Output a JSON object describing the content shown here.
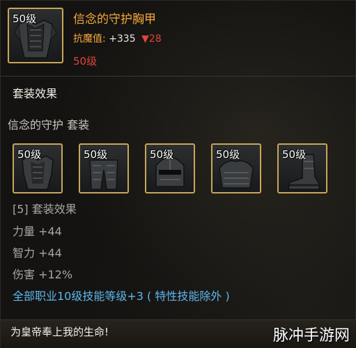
{
  "item": {
    "level_badge": "50级",
    "name": "信念的守护胸甲",
    "stat_label": "抗魔值:",
    "stat_value": "+335",
    "stat_diff": "▼28",
    "required_level": "50级",
    "icon": "chest-armor-icon"
  },
  "set": {
    "section_title": "套装效果",
    "set_name": "信念的守护  套装",
    "pieces": [
      {
        "level_badge": "50级",
        "icon": "chest-armor-icon"
      },
      {
        "level_badge": "50级",
        "icon": "pants-armor-icon"
      },
      {
        "level_badge": "50级",
        "icon": "helmet-icon"
      },
      {
        "level_badge": "50级",
        "icon": "shoulder-armor-icon"
      },
      {
        "level_badge": "50级",
        "icon": "boots-icon"
      }
    ],
    "bonus_header": "[5] 套装效果",
    "bonuses": [
      "力量 +44",
      "智力 +44",
      "伤害 +12%"
    ],
    "skill_bonus": "全部职业10级技能等级+3 ( 特性技能除外 )"
  },
  "flavor_text": "为皇帝奉上我的生命!",
  "watermark": "脉冲手游网",
  "colors": {
    "item_name": "#f6a93a",
    "stat_decrease": "#e0443a",
    "skill_bonus": "#5db7ee",
    "slot_border": "#c9a75a"
  }
}
